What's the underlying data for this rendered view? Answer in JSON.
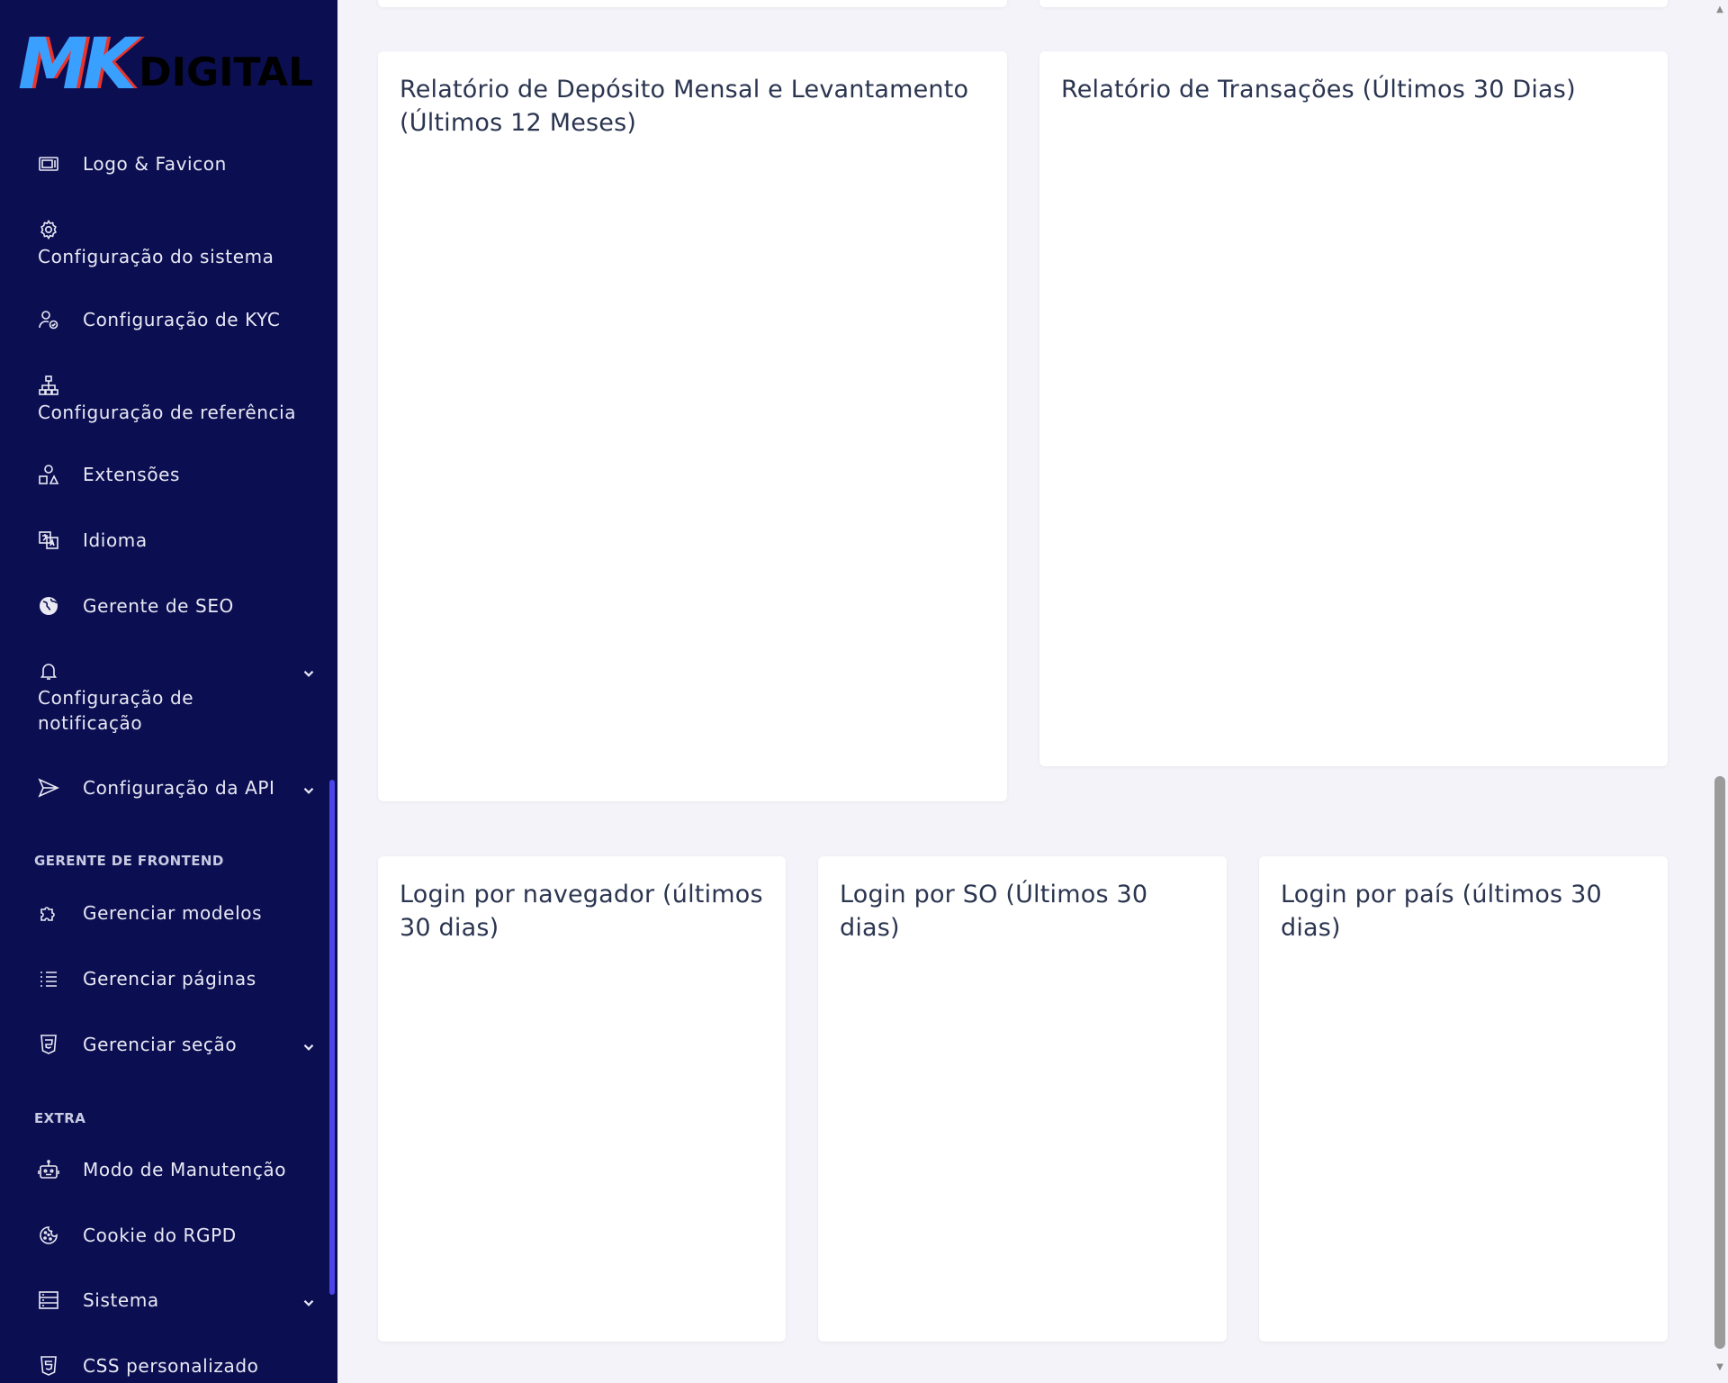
{
  "logo": {
    "mk": "MK",
    "digital": "DIGITAL"
  },
  "sidebar": {
    "items": [
      {
        "label": "Logo & Favicon",
        "icon": "image-frame-icon"
      },
      {
        "label": "Configuração do sistema",
        "icon": "gear-icon"
      },
      {
        "label": "Configuração de KYC",
        "icon": "user-check-icon"
      },
      {
        "label": "Configuração de referência",
        "icon": "hierarchy-icon"
      },
      {
        "label": "Extensões",
        "icon": "shapes-icon"
      },
      {
        "label": "Idioma",
        "icon": "language-icon"
      },
      {
        "label": "Gerente de SEO",
        "icon": "globe-icon"
      },
      {
        "label_line1": "Configuração de",
        "label_line2": "notificação",
        "icon": "bell-icon"
      },
      {
        "label": "Configuração da API",
        "icon": "send-icon"
      },
      {
        "label": "Gerenciar modelos",
        "icon": "puzzle-icon"
      },
      {
        "label": "Gerenciar páginas",
        "icon": "list-icon"
      },
      {
        "label": "Gerenciar seção",
        "icon": "html5-icon"
      },
      {
        "label": "Modo de Manutenção",
        "icon": "robot-icon"
      },
      {
        "label": "Cookie do RGPD",
        "icon": "cookie-icon"
      },
      {
        "label": "Sistema",
        "icon": "server-icon"
      },
      {
        "label": "CSS personalizado",
        "icon": "css3-icon"
      }
    ],
    "sections": {
      "frontend": "GERENTE DE FRONTEND",
      "extra": "EXTRA"
    }
  },
  "cards": {
    "deposit_report": "Relatório de Depósito Mensal e Levantamento (Últimos 12 Meses)",
    "transactions_report": "Relatório de Transações (Últimos 30 Dias)",
    "login_browser": "Login por navegador (últimos 30 dias)",
    "login_os": "Login por SO (Últimos 30 dias)",
    "login_country": "Login por país (últimos 30 dias)"
  },
  "colors": {
    "sidebar_bg": "#0b0f52",
    "sidebar_scroll": "#4b44e6",
    "page_bg": "#f3f3f9",
    "card_title": "#2b3550"
  }
}
